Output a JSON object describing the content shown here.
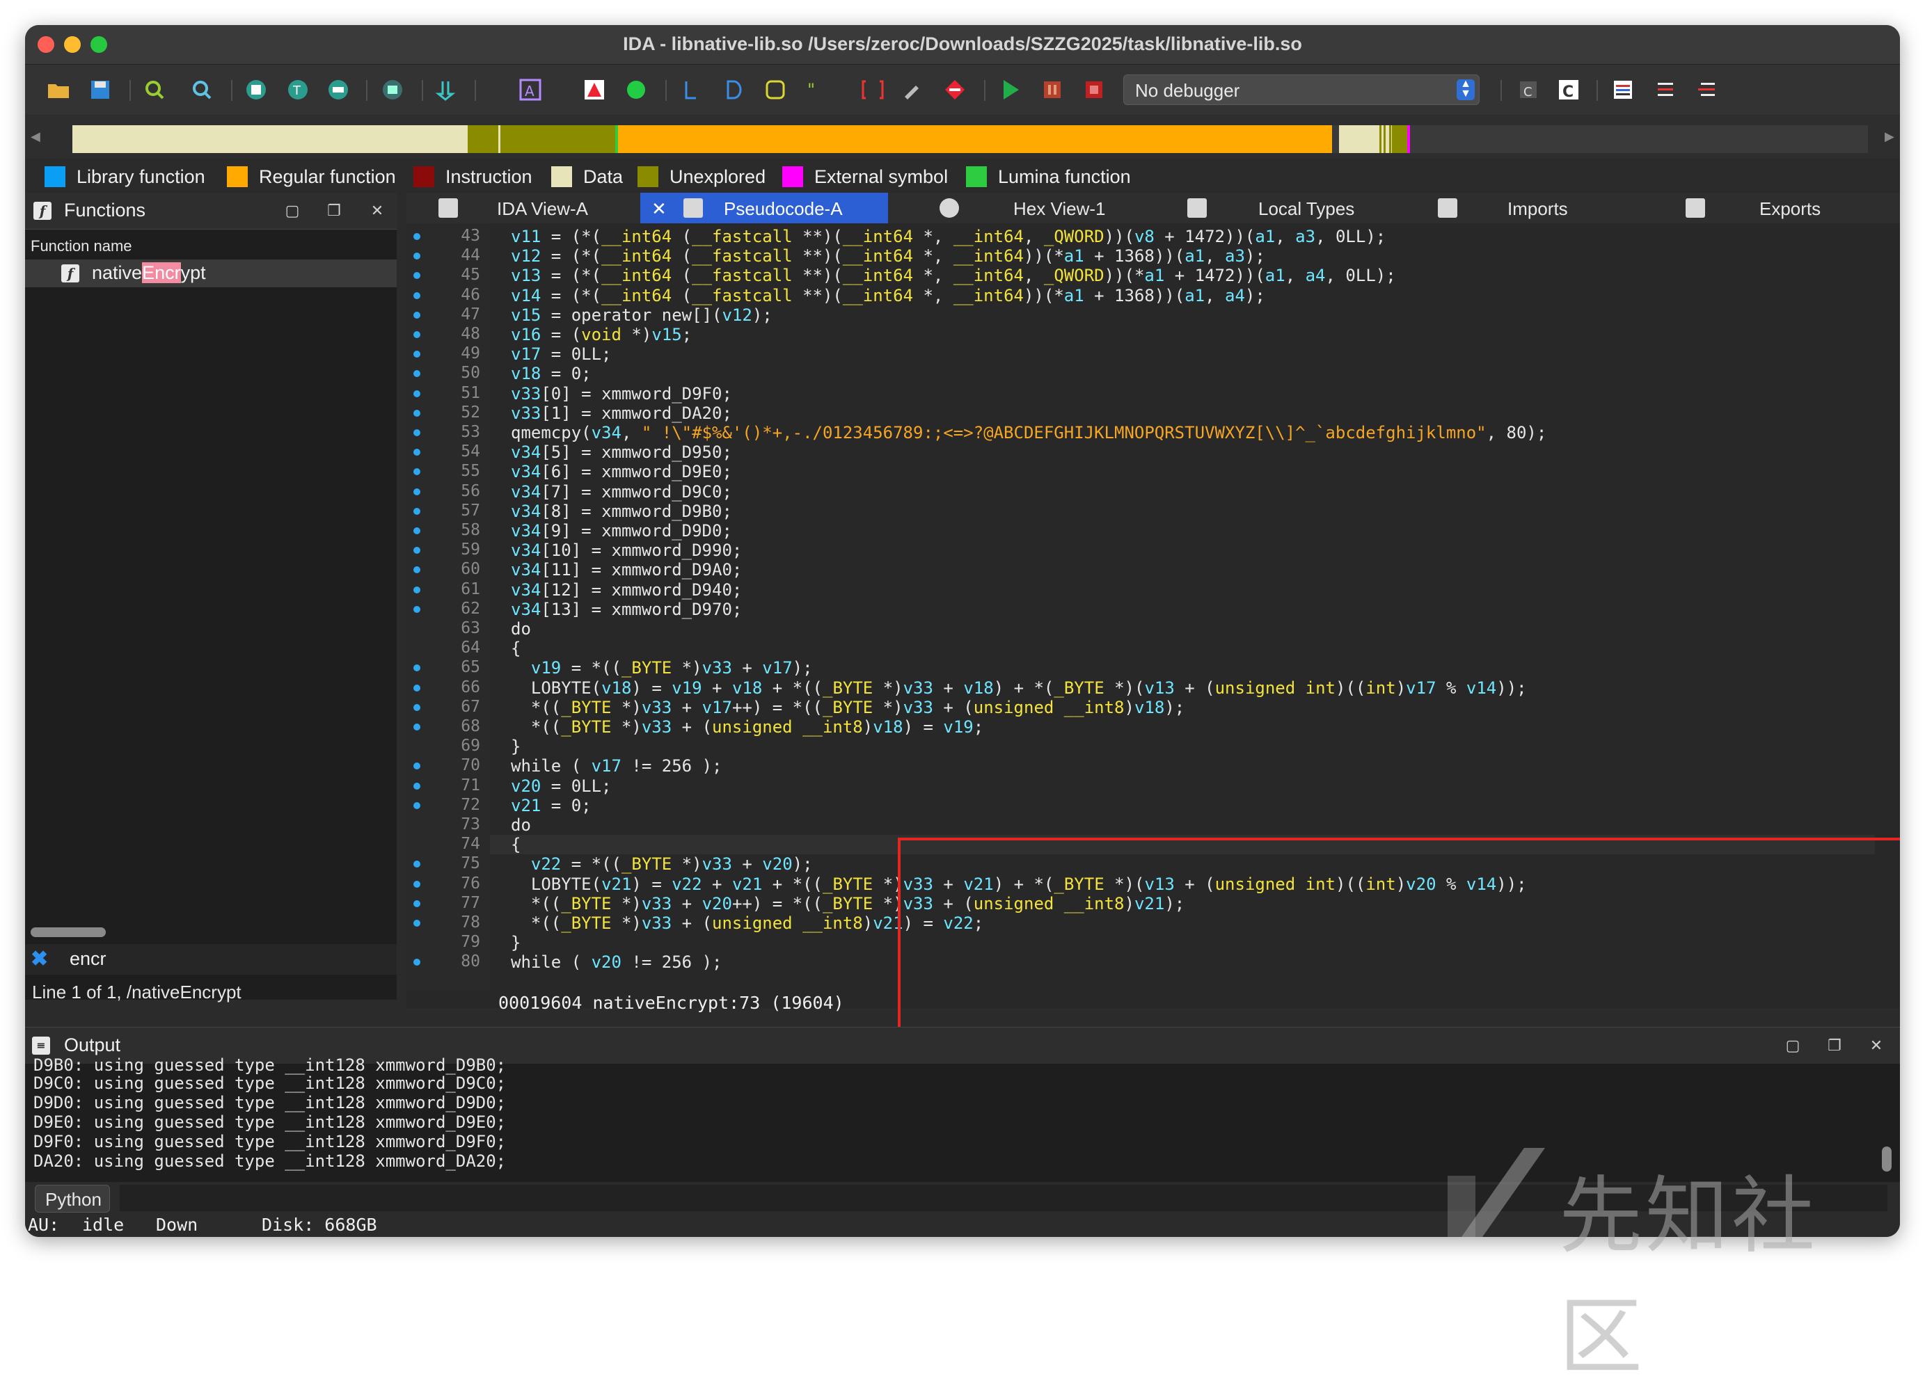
{
  "window": {
    "title": "IDA - libnative-lib.so /Users/zeroc/Downloads/SZZG2025/task/libnative-lib.so"
  },
  "toolbar": {
    "debugger_select": "No debugger"
  },
  "legend": [
    {
      "label": "Library function",
      "color": "#0a9ff5"
    },
    {
      "label": "Regular function",
      "color": "#ffaa00"
    },
    {
      "label": "Instruction",
      "color": "#8b0b0b"
    },
    {
      "label": "Data",
      "color": "#e6e4b8"
    },
    {
      "label": "Unexplored",
      "color": "#8b8b00"
    },
    {
      "label": "External symbol",
      "color": "#ff00ff"
    },
    {
      "label": "Lumina function",
      "color": "#2ecc40"
    }
  ],
  "functions_panel": {
    "title": "Functions",
    "column_header": "Function name",
    "rows": [
      {
        "name_prefix": "native",
        "name_highlight": "Encr",
        "name_suffix": "ypt"
      }
    ],
    "filter_value": "encr",
    "line_info": "Line 1 of 1, /nativeEncrypt"
  },
  "tabs": [
    {
      "label": "IDA View-A",
      "active": false
    },
    {
      "label": "Pseudocode-A",
      "active": true
    },
    {
      "label": "Hex View-1",
      "active": false
    },
    {
      "label": "Local Types",
      "active": false
    },
    {
      "label": "Imports",
      "active": false
    },
    {
      "label": "Exports",
      "active": false
    }
  ],
  "code": {
    "lines": [
      {
        "n": "43",
        "dot": true,
        "text": "v11 = (*(__int64 (__fastcall **)(__int64 *, __int64, _QWORD))(v8 + 1472))(a1, a3, 0LL);"
      },
      {
        "n": "44",
        "dot": true,
        "text": "v12 = (*(__int64 (__fastcall **)(__int64 *, __int64))(*a1 + 1368))(a1, a3);"
      },
      {
        "n": "45",
        "dot": true,
        "text": "v13 = (*(__int64 (__fastcall **)(__int64 *, __int64, _QWORD))(*a1 + 1472))(a1, a4, 0LL);"
      },
      {
        "n": "46",
        "dot": true,
        "text": "v14 = (*(__int64 (__fastcall **)(__int64 *, __int64))(*a1 + 1368))(a1, a4);"
      },
      {
        "n": "47",
        "dot": true,
        "text": "v15 = operator new[](v12);"
      },
      {
        "n": "48",
        "dot": true,
        "text": "v16 = (void *)v15;"
      },
      {
        "n": "49",
        "dot": true,
        "text": "v17 = 0LL;"
      },
      {
        "n": "50",
        "dot": true,
        "text": "v18 = 0;"
      },
      {
        "n": "51",
        "dot": true,
        "text": "v33[0] = xmmword_D9F0;"
      },
      {
        "n": "52",
        "dot": true,
        "text": "v33[1] = xmmword_DA20;"
      },
      {
        "n": "53",
        "dot": true,
        "text": "qmemcpy(v34, \" !\\\"#$%&'()*+,-./0123456789:;<=>?@ABCDEFGHIJKLMNOPQRSTUVWXYZ[\\\\]^_`abcdefghijklmno\", 80);"
      },
      {
        "n": "54",
        "dot": true,
        "text": "v34[5] = xmmword_D950;"
      },
      {
        "n": "55",
        "dot": true,
        "text": "v34[6] = xmmword_D9E0;"
      },
      {
        "n": "56",
        "dot": true,
        "text": "v34[7] = xmmword_D9C0;"
      },
      {
        "n": "57",
        "dot": true,
        "text": "v34[8] = xmmword_D9B0;"
      },
      {
        "n": "58",
        "dot": true,
        "text": "v34[9] = xmmword_D9D0;"
      },
      {
        "n": "59",
        "dot": true,
        "text": "v34[10] = xmmword_D990;"
      },
      {
        "n": "60",
        "dot": true,
        "text": "v34[11] = xmmword_D9A0;"
      },
      {
        "n": "61",
        "dot": true,
        "text": "v34[12] = xmmword_D940;"
      },
      {
        "n": "62",
        "dot": true,
        "text": "v34[13] = xmmword_D970;"
      },
      {
        "n": "63",
        "dot": false,
        "text": "do"
      },
      {
        "n": "64",
        "dot": false,
        "text": "{"
      },
      {
        "n": "65",
        "dot": true,
        "text": "  v19 = *((_BYTE *)v33 + v17);"
      },
      {
        "n": "66",
        "dot": true,
        "text": "  LOBYTE(v18) = v19 + v18 + *((_BYTE *)v33 + v18) + *(_BYTE *)(v13 + (unsigned int)((int)v17 % v14));"
      },
      {
        "n": "67",
        "dot": true,
        "text": "  *((_BYTE *)v33 + v17++) = *((_BYTE *)v33 + (unsigned __int8)v18);"
      },
      {
        "n": "68",
        "dot": true,
        "text": "  *((_BYTE *)v33 + (unsigned __int8)v18) = v19;"
      },
      {
        "n": "69",
        "dot": false,
        "text": "}"
      },
      {
        "n": "70",
        "dot": true,
        "text": "while ( v17 != 256 );"
      },
      {
        "n": "71",
        "dot": true,
        "text": "v20 = 0LL;"
      },
      {
        "n": "72",
        "dot": true,
        "text": "v21 = 0;"
      },
      {
        "n": "73",
        "dot": false,
        "text": "do"
      },
      {
        "n": "74",
        "dot": false,
        "text": "{"
      },
      {
        "n": "75",
        "dot": true,
        "text": "  v22 = *((_BYTE *)v33 + v20);"
      },
      {
        "n": "76",
        "dot": true,
        "text": "  LOBYTE(v21) = v22 + v21 + *((_BYTE *)v33 + v21) + *(_BYTE *)(v13 + (unsigned int)((int)v20 % v14));"
      },
      {
        "n": "77",
        "dot": true,
        "text": "  *((_BYTE *)v33 + v20++) = *((_BYTE *)v33 + (unsigned __int8)v21);"
      },
      {
        "n": "78",
        "dot": true,
        "text": "  *((_BYTE *)v33 + (unsigned __int8)v21) = v22;"
      },
      {
        "n": "79",
        "dot": false,
        "text": "}"
      },
      {
        "n": "80",
        "dot": true,
        "text": "while ( v20 != 256 );"
      }
    ],
    "status": "00019604 nativeEncrypt:73 (19604)"
  },
  "output": {
    "title": "Output",
    "lines": [
      "D9B0: using guessed type __int128 xmmword_D9B0;",
      "D9C0: using guessed type __int128 xmmword_D9C0;",
      "D9D0: using guessed type __int128 xmmword_D9D0;",
      "D9E0: using guessed type __int128 xmmword_D9E0;",
      "D9F0: using guessed type __int128 xmmword_D9F0;",
      "DA20: using guessed type __int128 xmmword_DA20;"
    ],
    "python_button": "Python"
  },
  "statusbar": {
    "au_label": "AU:",
    "au_state": "idle",
    "direction": "Down",
    "disk": "Disk: 668GB"
  },
  "watermark": {
    "text": "先知社区"
  }
}
